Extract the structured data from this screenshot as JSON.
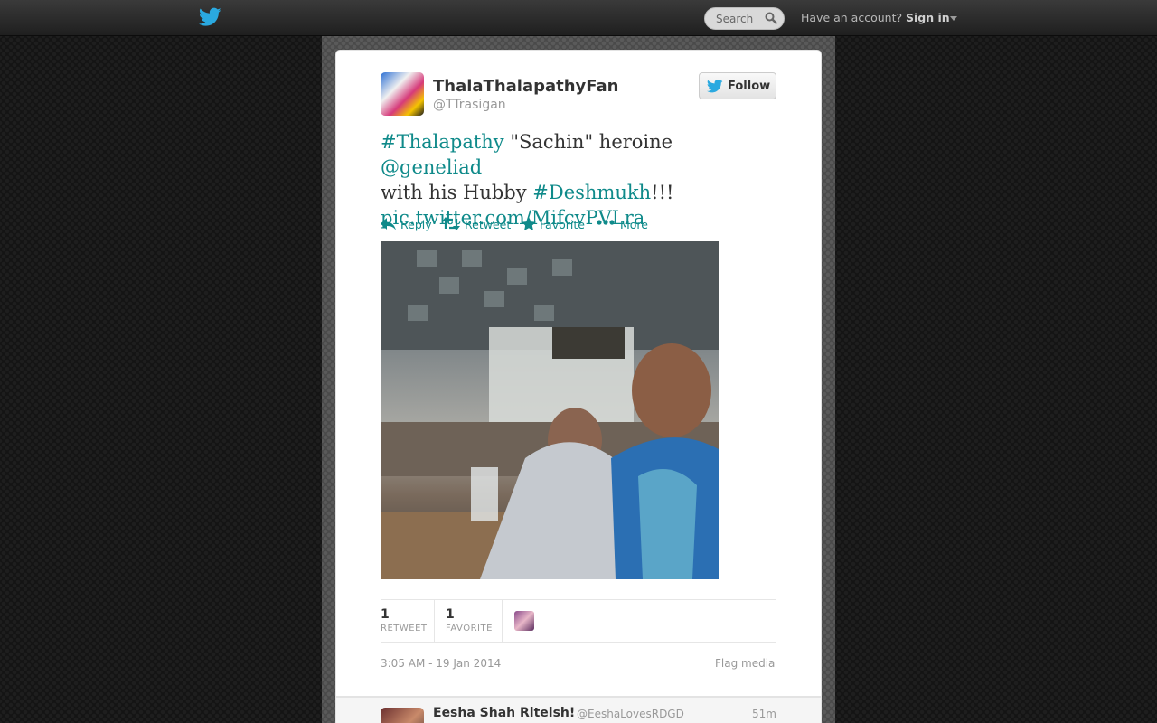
{
  "nav": {
    "search_placeholder": "Search",
    "have_account": "Have an account?",
    "sign_in": "Sign in",
    "brand_color": "#2aa9e0"
  },
  "tweet": {
    "display_name": "ThalaThalapathyFan",
    "handle": "@TTrasigan",
    "follow_label": "Follow",
    "text": {
      "hashtag1": "#Thalapathy",
      "part1": " \"Sachin\" heroine ",
      "mention": "@geneliad",
      "part2": "with his Hubby ",
      "hashtag2": "#Deshmukh",
      "part3": "!!!",
      "link": "pic.twitter.com/MifcvPVLra"
    },
    "actions": {
      "reply": "Reply",
      "retweet": "Retweet",
      "favorite": "Favorite",
      "more": "More"
    },
    "stats": {
      "retweet_count": "1",
      "retweet_label": "RETWEET",
      "favorite_count": "1",
      "favorite_label": "FAVORITE"
    },
    "timestamp": "3:05 AM - 19 Jan 2014",
    "flag_media": "Flag media",
    "link_color": "#0f8a8a"
  },
  "reply": {
    "display_name": "Eesha Shah Riteish!",
    "handle": "@EeshaLovesRDGD",
    "time": "51m"
  }
}
